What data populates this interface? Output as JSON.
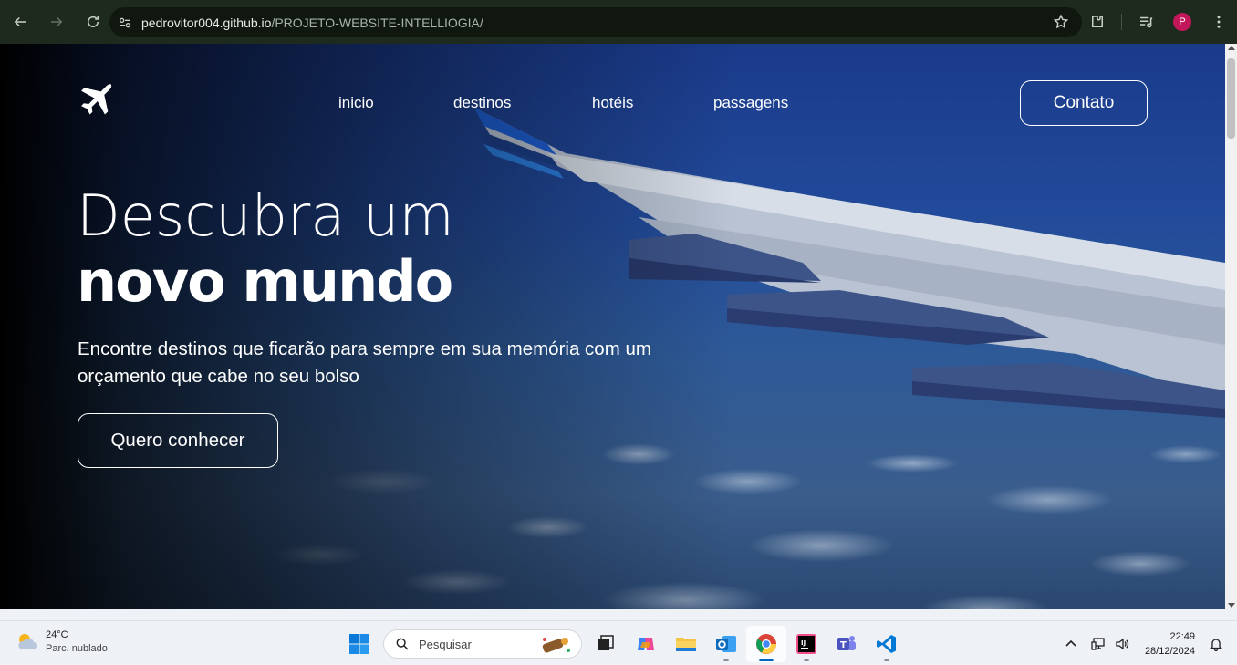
{
  "browser": {
    "url_host": "pedrovitor004.github.io",
    "url_path": "/PROJETO-WEBSITE-INTELLIOGIA/",
    "profile_initial": "P",
    "icons": [
      "back-icon",
      "forward-icon",
      "reload-icon",
      "site-info-icon",
      "bookmark-star-icon",
      "extensions-icon",
      "media-controls-icon",
      "kebab-menu-icon"
    ]
  },
  "site": {
    "nav": [
      "inicio",
      "destinos",
      "hotéis",
      "passagens"
    ],
    "contact_label": "Contato",
    "headline_light": "Descubra um",
    "headline_bold": "novo mundo",
    "subtitle": "Encontre destinos que ficarão para sempre em sua memória com um orçamento que cabe no seu bolso",
    "cta_label": "Quero conhecer",
    "logo_icon": "airplane-icon"
  },
  "taskbar": {
    "temperature": "24°C",
    "condition": "Parc. nublado",
    "search_placeholder": "Pesquisar",
    "apps": [
      "start",
      "task-view",
      "copilot",
      "file-explorer",
      "outlook",
      "chrome",
      "jetbrains",
      "teams",
      "vscode"
    ],
    "time": "22:49",
    "date": "28/12/2024"
  },
  "colors": {
    "chrome_bg": "#1e2a1e",
    "taskbar_bg": "#eef1f5",
    "profile": "#c2185b"
  }
}
